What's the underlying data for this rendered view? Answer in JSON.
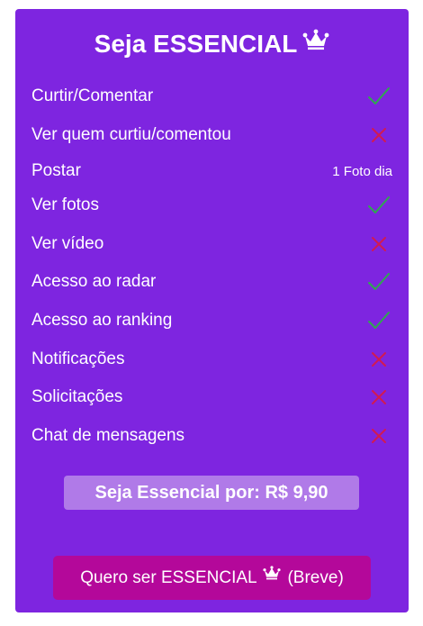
{
  "plan": {
    "title": "Seja ESSENCIAL",
    "crown_icon": "crown-icon",
    "colors": {
      "card": "#7e25e0",
      "check": "#2fa84f",
      "cross": "#d11a52",
      "price_badge": "#b07ae8",
      "cta": "#b4089a"
    }
  },
  "features": [
    {
      "label": "Curtir/Comentar",
      "status": "check"
    },
    {
      "label": "Ver quem curtiu/comentou",
      "status": "cross"
    },
    {
      "label": "Postar",
      "status": "text",
      "status_text": "1 Foto dia"
    },
    {
      "label": "Ver fotos",
      "status": "check"
    },
    {
      "label": "Ver vídeo",
      "status": "cross"
    },
    {
      "label": "Acesso ao radar",
      "status": "check"
    },
    {
      "label": "Acesso ao ranking",
      "status": "check"
    },
    {
      "label": "Notificações",
      "status": "cross"
    },
    {
      "label": "Solicitações",
      "status": "cross"
    },
    {
      "label": "Chat de mensagens",
      "status": "cross"
    }
  ],
  "price": {
    "label": "Seja Essencial por: R$ 9,90"
  },
  "cta": {
    "label_before": "Quero ser ESSENCIAL",
    "label_after": "(Breve)"
  }
}
